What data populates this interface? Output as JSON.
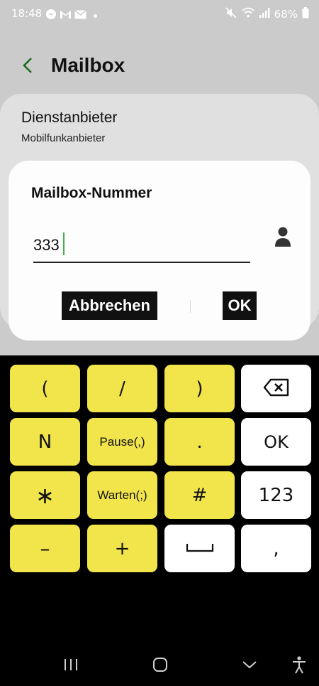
{
  "status_bar": {
    "time": "18:48",
    "battery": "68%",
    "left_icons": [
      "messenger-icon",
      "gmail-icon",
      "mail-icon",
      "dot-icon"
    ],
    "right_icons": [
      "mute-icon",
      "wifi-icon",
      "signal-icon",
      "battery-icon"
    ]
  },
  "header": {
    "title": "Mailbox"
  },
  "card": {
    "title": "Dienstanbieter",
    "subtitle": "Mobilfunkanbieter"
  },
  "dialog": {
    "title": "Mailbox-Nummer",
    "value": "333",
    "cancel_label": "Abbrechen",
    "ok_label": "OK"
  },
  "keypad": {
    "keys": [
      [
        "(",
        "/",
        ")",
        ""
      ],
      [
        "N",
        "Pause(,)",
        ".",
        "OK"
      ],
      [
        "∗",
        "Warten(;)",
        "#",
        "123"
      ],
      [
        "–",
        "+",
        "",
        ","
      ]
    ]
  },
  "colors": {
    "key_yellow": "#f2e44b",
    "accent_green": "#2e9e2e"
  }
}
